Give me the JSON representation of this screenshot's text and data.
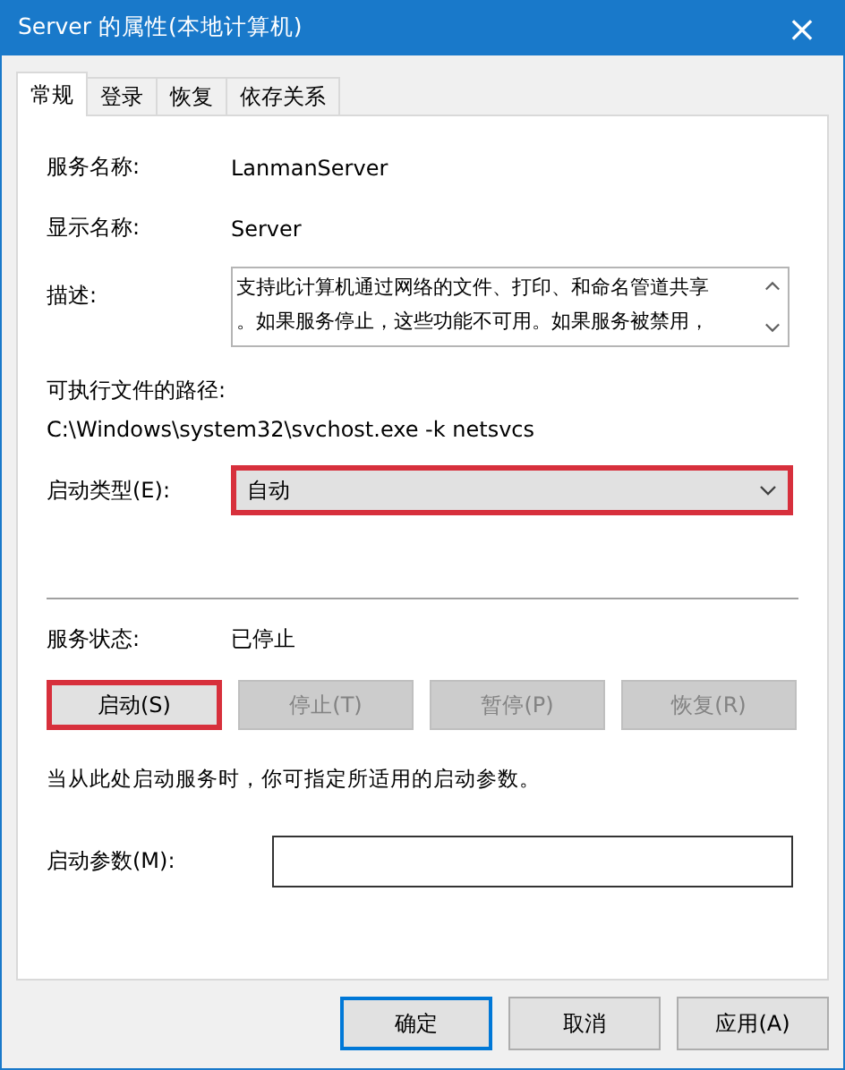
{
  "window": {
    "title": "Server 的属性(本地计算机)",
    "close": "×"
  },
  "tabs": [
    {
      "label": "常规",
      "selected": true
    },
    {
      "label": "登录",
      "selected": false
    },
    {
      "label": "恢复",
      "selected": false
    },
    {
      "label": "依存关系",
      "selected": false
    }
  ],
  "service_name": {
    "label": "服务名称:",
    "value": "LanmanServer"
  },
  "display_name": {
    "label": "显示名称:",
    "value": "Server"
  },
  "description": {
    "label": "描述:",
    "lines": [
      "支持此计算机通过网络的文件、打印、和命名管道共享",
      "。如果服务停止，这些功能不可用。如果服务被禁用，"
    ]
  },
  "executable_path": {
    "label": "可执行文件的路径:",
    "value": "C:\\Windows\\system32\\svchost.exe -k netsvcs"
  },
  "startup_type": {
    "label": "启动类型(E):",
    "value": "自动",
    "highlighted": true
  },
  "service_status": {
    "label": "服务状态:",
    "value": "已停止"
  },
  "service_buttons": [
    {
      "label": "启动(S)",
      "disabled": false,
      "highlighted": true
    },
    {
      "label": "停止(T)",
      "disabled": true,
      "highlighted": false
    },
    {
      "label": "暂停(P)",
      "disabled": true,
      "highlighted": false
    },
    {
      "label": "恢复(R)",
      "disabled": true,
      "highlighted": false
    }
  ],
  "hint": "当从此处启动服务时，你可指定所适用的启动参数。",
  "start_parameters": {
    "label": "启动参数(M):"
  },
  "buttons": [
    {
      "label": "确定",
      "default": true
    },
    {
      "label": "取消",
      "default": false
    },
    {
      "label": "应用(A)",
      "default": false
    }
  ]
}
